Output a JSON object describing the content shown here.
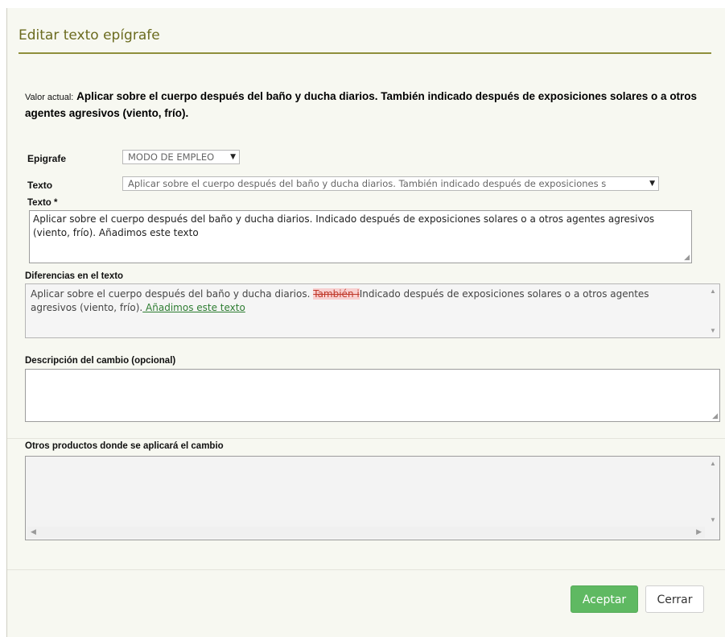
{
  "dialog": {
    "title": "Editar texto epígrafe",
    "current_value_label": "Valor actual:",
    "current_value_text": "Aplicar sobre el cuerpo después del baño y ducha diarios. También indicado después de exposiciones solares o a otros agentes agresivos (viento, frío).",
    "epigrafe_label": "Epigrafe",
    "epigrafe_value": "MODO DE EMPLEO",
    "texto_select_label": "Texto",
    "texto_select_value": "Aplicar sobre el cuerpo después del baño y ducha diarios. También indicado después de exposiciones s",
    "texto_label": "Texto *",
    "texto_value": "Aplicar sobre el cuerpo después del baño y ducha diarios. Indicado después de exposiciones solares o a otros agentes agresivos (viento, frío). Añadimos este texto",
    "diff_label": "Diferencias en el texto",
    "diff": {
      "part1": "Aplicar sobre el cuerpo después del baño y ducha diarios. ",
      "deleted": "También i",
      "part2": "Indicado después de exposiciones solares o a otros agentes agresivos (viento, frío).",
      "inserted": " Añadimos este texto"
    },
    "description_label": "Descripción del cambio (opcional)",
    "description_value": "",
    "products_label": "Otros productos donde se aplicará el cambio",
    "accept_label": "Aceptar",
    "close_label": "Cerrar"
  },
  "colors": {
    "title": "#6b6b1f",
    "accent_green": "#5fb962",
    "diff_deleted": "#c0392b",
    "diff_inserted": "#2e7d32"
  },
  "icons": {
    "dropdown": "triangle-down",
    "resize": "resize-grip",
    "scroll_up": "triangle-up",
    "scroll_down": "triangle-down",
    "scroll_left": "triangle-left",
    "scroll_right": "triangle-right"
  }
}
